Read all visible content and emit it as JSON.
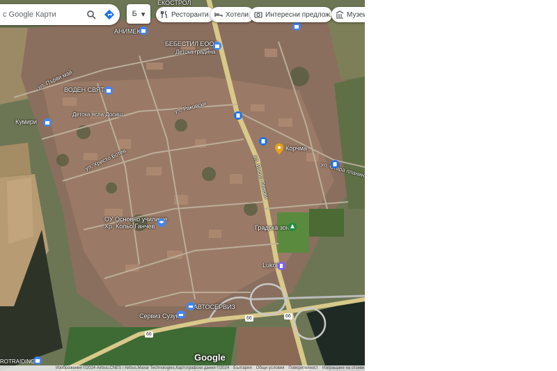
{
  "search": {
    "placeholder": "с Google Карти"
  },
  "layers": {
    "label": "Б"
  },
  "chips": [
    {
      "label": "Ресторанти",
      "icon": "fork-knife-icon"
    },
    {
      "label": "Хотели",
      "icon": "bed-icon"
    },
    {
      "label": "Интересни предлож...",
      "icon": "camera-icon"
    },
    {
      "label": "Музеи",
      "icon": "museum-icon"
    }
  ],
  "map_labels": {
    "ekostrol": "ЕКОСТРОЛ",
    "animeks": "АНИМЕКС",
    "bebestil": "БЕБЕСТИЛ ЕООД",
    "gradina": "Детска градина",
    "vodenzvyat": "ВОДЕН СВЯТ",
    "detska_yasla": "Детска ясла Досиш",
    "kumiri": "Кумири",
    "loka": "Корчма",
    "uchilishte": "ОУ Основно училище",
    "hristo": "Хр. Кольо Ганчев",
    "stadium": "Градска зона",
    "lukoil": "Lukoil",
    "avtoservice": "АВТОСЕРВИЗ",
    "sirius": "Сервиз Сузуки",
    "troiding": "ROTRAIDING",
    "road_ul1": "ул. Първи май",
    "road_ul2": "ул. Васил Левски",
    "road_ul3": "ул. Раковски",
    "road_ul4": "ул. Христо Ботев",
    "road_ul5": "ул. Стара планина"
  },
  "route_numbers": {
    "a": "66",
    "b": "66",
    "c": "66"
  },
  "brand": "Google",
  "footer": {
    "imagery": "Изображения ©2024 Airbus,CNES / Airbus,Maxar Technologies,Картографски данни ©2024",
    "lang": "България",
    "terms": "Общи условия",
    "privacy": "Поверителност",
    "feedback": "Изпращане на отзиви"
  }
}
